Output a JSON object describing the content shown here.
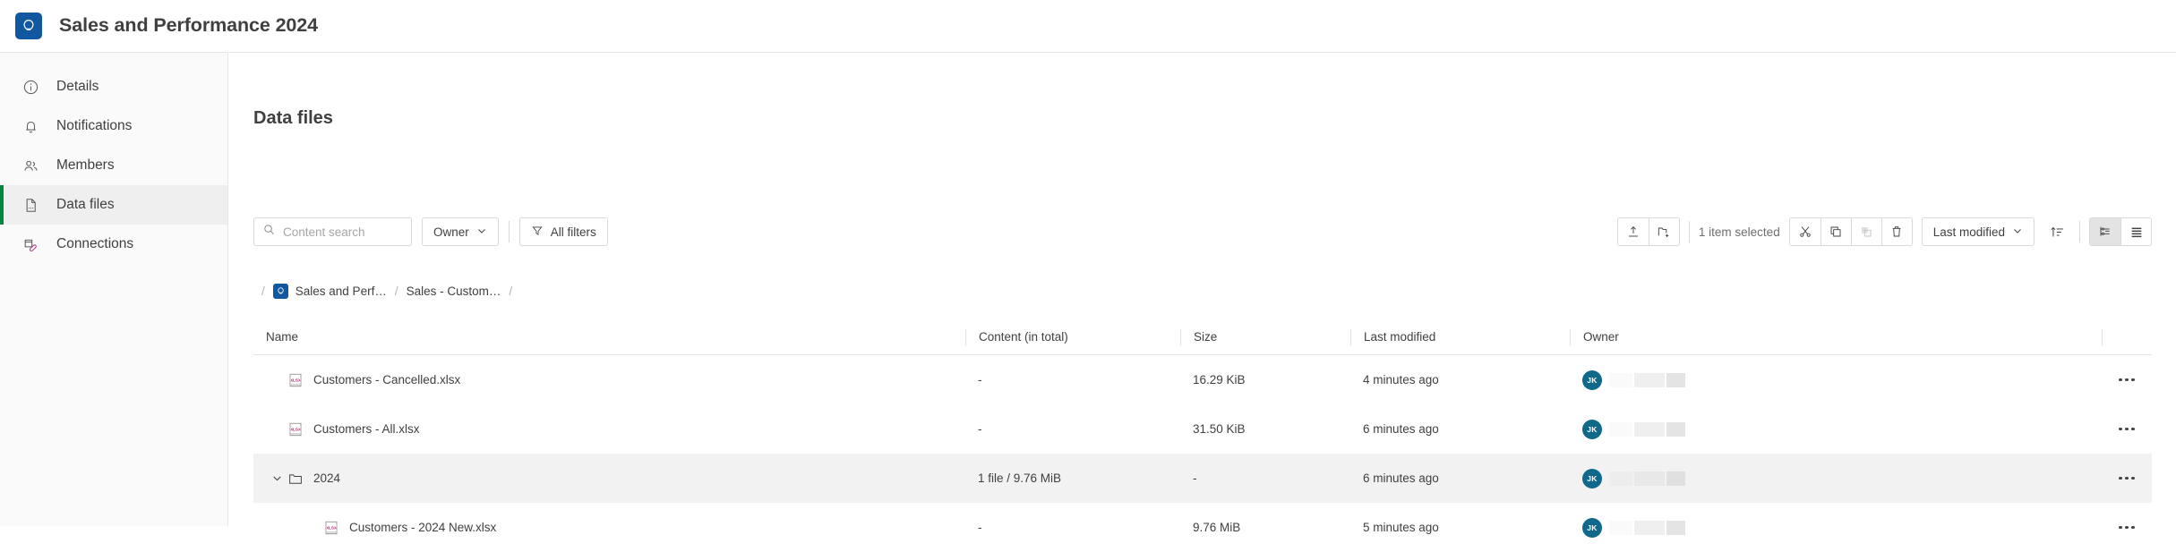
{
  "header": {
    "logo_icon": "qlik-logo-icon",
    "title": "Sales and Performance 2024"
  },
  "sidebar": {
    "items": [
      {
        "icon": "info-circle-icon",
        "label": "Details",
        "active": false
      },
      {
        "icon": "bell-icon",
        "label": "Notifications",
        "active": false
      },
      {
        "icon": "members-icon",
        "label": "Members",
        "active": false
      },
      {
        "icon": "data-file-icon",
        "label": "Data files",
        "active": true
      },
      {
        "icon": "connections-icon",
        "label": "Connections",
        "active": false
      }
    ],
    "active_accent_color": "#00873d",
    "active_bg_color": "#efefef"
  },
  "main": {
    "page_title": "Data files",
    "toolbar": {
      "search": {
        "placeholder": "Content search",
        "value": ""
      },
      "owner_filter_label": "Owner",
      "all_filters_label": "All filters",
      "upload_icon": "upload-icon",
      "new_folder_icon": "new-folder-icon",
      "selection_label": "1 item selected",
      "cut_icon": "scissors-icon",
      "copy_icon": "copy-icon",
      "paste_icon": "paste-icon",
      "delete_icon": "trash-icon",
      "sort_by_label": "Last modified",
      "sort_direction_icon": "sort-ascending-icon",
      "tree_view_icon": "tree-view-icon",
      "list_view_icon": "list-view-icon"
    },
    "breadcrumb": {
      "leading_separator": "/",
      "space_icon": "qlik-space-icon",
      "items": [
        {
          "label": "Sales and Perf…"
        },
        {
          "label": "Sales - Custom…"
        }
      ],
      "separator": "/",
      "trailing_separator": "/"
    },
    "table": {
      "columns": [
        "Name",
        "Content (in total)",
        "Size",
        "Last modified",
        "Owner"
      ],
      "rows": [
        {
          "icon": "xlsx-file-icon",
          "kind": "file",
          "indent": 1,
          "expandable": false,
          "expanded": false,
          "name": "Customers - Cancelled.xlsx",
          "content": "-",
          "size": "16.29 KiB",
          "last_modified": "4 minutes ago",
          "owner_initials": "JK",
          "selected": false,
          "action_icon": "more-actions-icon"
        },
        {
          "icon": "xlsx-file-icon",
          "kind": "file",
          "indent": 1,
          "expandable": false,
          "expanded": false,
          "name": "Customers - All.xlsx",
          "content": "-",
          "size": "31.50 KiB",
          "last_modified": "6 minutes ago",
          "owner_initials": "JK",
          "selected": false,
          "action_icon": "more-actions-icon"
        },
        {
          "icon": "folder-icon",
          "kind": "folder",
          "indent": 0,
          "expandable": true,
          "expanded": true,
          "name": "2024",
          "content": "1 file / 9.76 MiB",
          "size": "-",
          "last_modified": "6 minutes ago",
          "owner_initials": "JK",
          "selected": true,
          "action_icon": "more-actions-icon"
        },
        {
          "icon": "xlsx-file-icon",
          "kind": "file",
          "indent": 2,
          "expandable": false,
          "expanded": false,
          "name": "Customers - 2024 New.xlsx",
          "content": "-",
          "size": "9.76 MiB",
          "last_modified": "5 minutes ago",
          "owner_initials": "JK",
          "selected": false,
          "action_icon": "more-actions-icon"
        }
      ]
    }
  },
  "colors": {
    "brand_blue": "#1258a0",
    "accent_green": "#00873d",
    "avatar_teal": "#10688a",
    "xlsx_magenta": "#ad1f68",
    "text": "#404040",
    "muted_text": "#6e6e6e",
    "border": "#d9d9d9",
    "selected_row": "#f2f2f2",
    "sidebar_bg": "#fafafa"
  }
}
